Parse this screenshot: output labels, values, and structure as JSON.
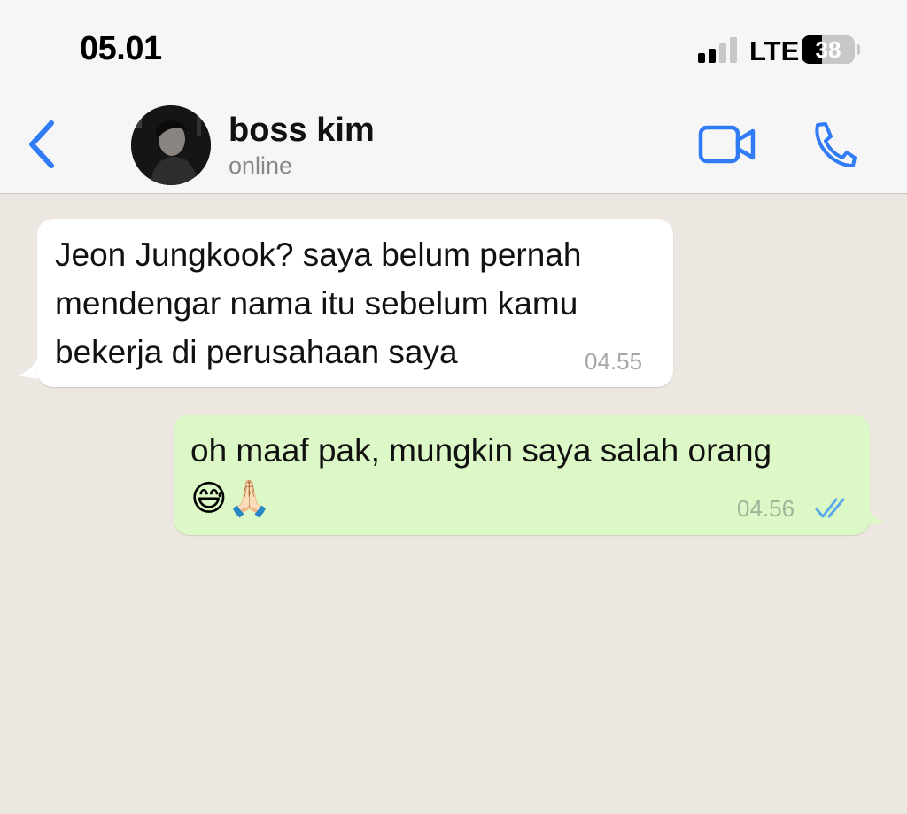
{
  "status_bar": {
    "time": "05.01",
    "network": "LTE",
    "battery": "38",
    "battery_level": 0.38
  },
  "header": {
    "back_icon": "chevron-left-icon",
    "contact_name": "boss kim",
    "contact_status": "online",
    "video_icon": "video-camera-icon",
    "call_icon": "phone-icon",
    "accent_color": "#2f7cf6"
  },
  "messages": [
    {
      "direction": "incoming",
      "text": "Jeon Jungkook? saya belum pernah mendengar nama itu sebelum kamu bekerja di perusahaan saya",
      "time": "04.55",
      "bubble_color": "#ffffff"
    },
    {
      "direction": "outgoing",
      "text": "oh maaf pak, mungkin saya salah orang",
      "emojis": "😅🙏🏻",
      "time": "04.56",
      "status_icon": "double-check-read-icon",
      "bubble_color": "#dcf8c6"
    }
  ],
  "chat_background": "#ece7e1"
}
